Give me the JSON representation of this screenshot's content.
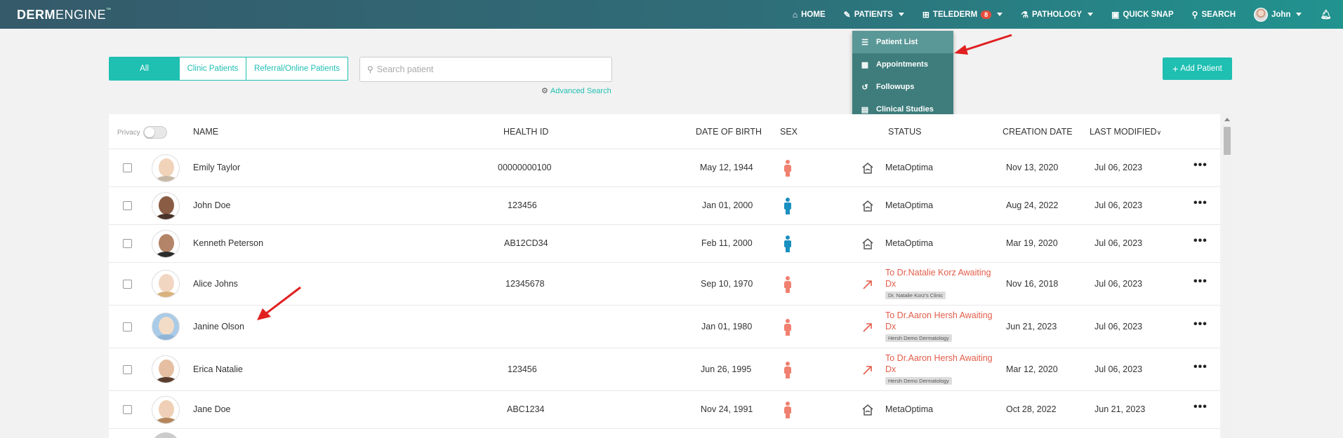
{
  "brand": {
    "logo_bold": "DERM",
    "logo_light": "ENGINE",
    "logo_tm": "™"
  },
  "nav": {
    "home": "HOME",
    "patients": "PATIENTS",
    "telederm": "TELEDERM",
    "telederm_badge": "8",
    "pathology": "PATHOLOGY",
    "quick_snap": "QUICK SNAP",
    "search": "SEARCH",
    "user": "John"
  },
  "patients_menu": {
    "items": [
      {
        "label": "Patient List",
        "icon": "list-icon"
      },
      {
        "label": "Appointments",
        "icon": "calendar-icon"
      },
      {
        "label": "Followups",
        "icon": "history-icon"
      },
      {
        "label": "Clinical Studies",
        "icon": "id-card-icon"
      }
    ]
  },
  "filters": {
    "all": "All",
    "clinic": "Clinic Patients",
    "referral": "Referral/Online Patients"
  },
  "search": {
    "placeholder": "Search patient",
    "advanced": "Advanced Search"
  },
  "add_patient": "Add Patient",
  "table": {
    "privacy_label": "Privacy",
    "headers": {
      "name": "NAME",
      "health_id": "HEALTH ID",
      "dob": "DATE OF BIRTH",
      "sex": "SEX",
      "status": "STATUS",
      "creation_date": "CREATION DATE",
      "last_modified": "LAST MODIFIED"
    },
    "rows": [
      {
        "name": "Emily Taylor",
        "health_id": "00000000100",
        "dob": "May 12, 1944",
        "sex": "female",
        "status": "MetaOptima",
        "status_tag": "",
        "created": "Nov 13, 2020",
        "modified": "Jul 06, 2023"
      },
      {
        "name": "John Doe",
        "health_id": "123456",
        "dob": "Jan 01, 2000",
        "sex": "male",
        "status": "MetaOptima",
        "status_tag": "",
        "created": "Aug 24, 2022",
        "modified": "Jul 06, 2023"
      },
      {
        "name": "Kenneth Peterson",
        "health_id": "AB12CD34",
        "dob": "Feb 11, 2000",
        "sex": "male",
        "status": "MetaOptima",
        "status_tag": "",
        "created": "Mar 19, 2020",
        "modified": "Jul 06, 2023"
      },
      {
        "name": "Alice Johns",
        "health_id": "12345678",
        "dob": "Sep 10, 1970",
        "sex": "female",
        "status_line1": "To Dr.Natalie Korz Awaiting",
        "status_line2": "Dx",
        "status_tag": "Dr. Natalie Korz's Clinic",
        "created": "Nov 16, 2018",
        "modified": "Jul 06, 2023"
      },
      {
        "name": "Janine Olson",
        "health_id": "",
        "dob": "Jan 01, 1980",
        "sex": "female",
        "status_line1": "To Dr.Aaron Hersh Awaiting",
        "status_line2": "Dx",
        "status_tag": "Hersh Demo Dermatology",
        "created": "Jun 21, 2023",
        "modified": "Jul 06, 2023"
      },
      {
        "name": "Erica Natalie",
        "health_id": "123456",
        "dob": "Jun 26, 1995",
        "sex": "female",
        "status_line1": "To Dr.Aaron Hersh Awaiting",
        "status_line2": "Dx",
        "status_tag": "Hersh Demo Dermatology",
        "created": "Mar 12, 2020",
        "modified": "Jul 06, 2023"
      },
      {
        "name": "Jane Doe",
        "health_id": "ABC1234",
        "dob": "Nov 24, 1991",
        "sex": "female",
        "status": "MetaOptima",
        "status_tag": "",
        "created": "Oct 28, 2022",
        "modified": "Jun 21, 2023"
      }
    ]
  },
  "colors": {
    "accent": "#1fbfb2",
    "female": "#f08070",
    "male": "#1a8fc0",
    "status_referral": "#e35d4a",
    "annotation_arrow": "#e02020"
  }
}
